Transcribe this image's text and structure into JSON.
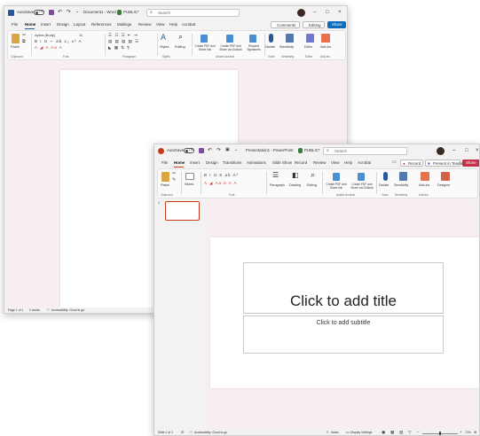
{
  "word": {
    "titlebar": {
      "autosave": "AutoSave",
      "toggle": "Off",
      "title": "Document1 - Word",
      "label": "PUBLIC*",
      "search_placeholder": "Search"
    },
    "menu": [
      "File",
      "Home",
      "Insert",
      "Design",
      "Layout",
      "References",
      "Mailings",
      "Review",
      "View",
      "Help",
      "Acrobat"
    ],
    "menu_right": {
      "comments": "Comments",
      "editing": "Editing",
      "share": "Share"
    },
    "ribbon": {
      "paste": "Paste",
      "font_name": "Aptos (Body)",
      "font_size": "11",
      "styles": "Styles",
      "editing": "Editing",
      "create_pdf": "Create PDF and Share link",
      "create_pdf_outlook": "Create PDF and Share via Outlook",
      "request_signatures": "Request Signatures",
      "dictate": "Dictate",
      "sensitivity": "Sensitivity",
      "editor": "Editor",
      "addins": "Add-ins"
    },
    "groups": [
      "Clipboard",
      "Font",
      "Paragraph",
      "Styles",
      "Adobe Acrobat",
      "Voice",
      "Sensitivity",
      "Editor",
      "Add-ins"
    ],
    "status": {
      "page": "Page 1 of 1",
      "words": "0 words",
      "accessibility": "Accessibility: Good to go"
    }
  },
  "ppt": {
    "titlebar": {
      "autosave": "AutoSave",
      "toggle": "Off",
      "title": "Presentation1 - PowerPoint",
      "label": "PUBLIC*",
      "search_placeholder": "Search"
    },
    "menu": [
      "File",
      "Home",
      "Insert",
      "Design",
      "Transitions",
      "Animations",
      "Slide Show",
      "Record",
      "Review",
      "View",
      "Help",
      "Acrobat"
    ],
    "menu_right": {
      "record": "Record",
      "present": "Present in Teams",
      "share": "Share"
    },
    "ribbon": {
      "paste": "Paste",
      "slides": "Slides",
      "paragraph": "Paragraph",
      "drawing": "Drawing",
      "editing": "Editing",
      "create_pdf": "Create PDF and Share link",
      "create_pdf_outlook": "Create PDF and Share via Outlook",
      "dictate": "Dictate",
      "sensitivity": "Sensitivity",
      "addins": "Add-ins",
      "designer": "Designer"
    },
    "groups": [
      "Clipboard",
      "Font",
      "Adobe Acrobat",
      "Voice",
      "Sensitivity",
      "Add-ins"
    ],
    "thumbnail_number": "1",
    "slide": {
      "title": "Click to add title",
      "subtitle": "Click to add subtitle"
    },
    "status": {
      "slide": "Slide 1 of 1",
      "accessibility": "Accessibility: Good to go",
      "notes": "Notes",
      "display": "Display Settings",
      "zoom": "72%"
    }
  },
  "colors": {
    "word_blue": "#2b579a",
    "ppt_orange": "#c43e1c",
    "share_blue": "#0f6cbd",
    "share_red": "#c4314b",
    "canvas_pink": "#f7eef0",
    "chrome": "#f3f1f2"
  }
}
